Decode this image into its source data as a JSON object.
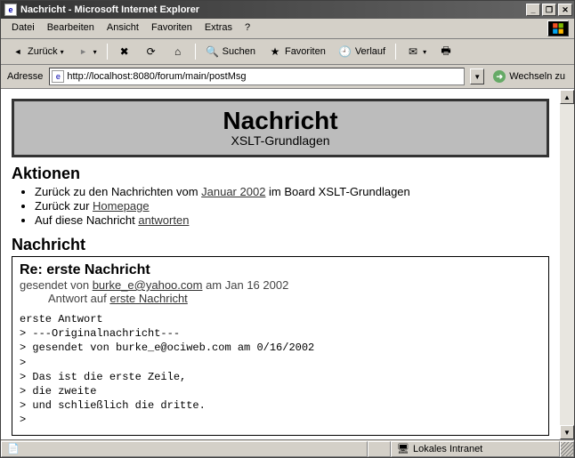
{
  "window": {
    "title": "Nachricht - Microsoft Internet Explorer"
  },
  "menu": {
    "datei": "Datei",
    "bearbeiten": "Bearbeiten",
    "ansicht": "Ansicht",
    "favoriten": "Favoriten",
    "extras": "Extras",
    "help": "?"
  },
  "toolbar": {
    "back": "Zurück",
    "search": "Suchen",
    "favorites": "Favoriten",
    "history": "Verlauf"
  },
  "address": {
    "label": "Adresse",
    "value": "http://localhost:8080/forum/main/postMsg",
    "go": "Wechseln zu"
  },
  "page": {
    "banner_title": "Nachricht",
    "banner_sub": "XSLT-Grundlagen",
    "actions_head": "Aktionen",
    "action1_pre": "Zurück zu den Nachrichten vom ",
    "action1_link": "Januar 2002",
    "action1_post": " im Board XSLT-Grundlagen",
    "action2_pre": "Zurück zur ",
    "action2_link": "Homepage",
    "action3_pre": "Auf diese Nachricht ",
    "action3_link": "antworten",
    "msg_head": "Nachricht",
    "msg_title": "Re: erste Nachricht",
    "sent_pre": "gesendet von ",
    "sent_email": "burke_e@yahoo.com",
    "sent_post": " am Jan 16 2002",
    "reply_pre": "Antwort auf ",
    "reply_link": "erste Nachricht",
    "body": "erste Antwort\n> ---Originalnachricht---\n> gesendet von burke_e@ociweb.com am 0/16/2002\n>\n> Das ist die erste Zeile,\n> die zweite\n> und schließlich die dritte.\n>"
  },
  "status": {
    "zone": "Lokales Intranet"
  }
}
